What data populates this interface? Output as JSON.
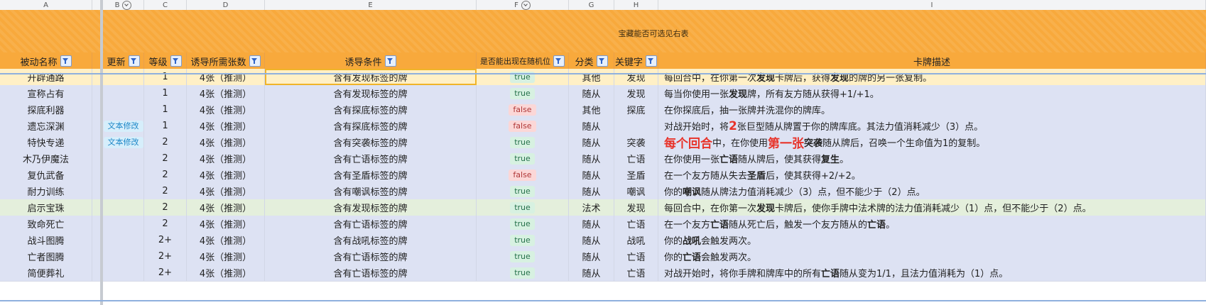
{
  "columns": [
    "A",
    "B",
    "C",
    "D",
    "E",
    "F",
    "G",
    "H",
    "I"
  ],
  "banner_text": "宝藏能否可选见右表",
  "headers": {
    "name": "被动名称",
    "update": "更新",
    "level": "等级",
    "cards_needed": "诱导所需张数",
    "condition": "诱导条件",
    "random_slot": "是否能出现在随机位",
    "category": "分类",
    "keyword": "关键字",
    "description": "卡牌描述"
  },
  "colors": {
    "header_orange": "#f8a93c",
    "row_default": "#dde2f3",
    "row_selected": "#fff0c6",
    "row_highlight": "#e4efdc",
    "true_pill": "#d7f1e1",
    "false_pill": "#fbd7d7",
    "emphasis_red": "#e8332a"
  },
  "rows": [
    {
      "name": "开辟通路",
      "update": "",
      "level": "1",
      "cards": "4张（推测）",
      "condition": "含有发现标签的牌",
      "random": "true",
      "category": "其他",
      "keyword": "发现",
      "desc": [
        {
          "t": "每回合中，在你第一次"
        },
        {
          "t": "发现",
          "b": true
        },
        {
          "t": "卡牌后，获得"
        },
        {
          "t": "发现",
          "b": true
        },
        {
          "t": "的牌的另一张复制。"
        }
      ]
    },
    {
      "name": "宣称占有",
      "update": "",
      "level": "1",
      "cards": "4张（推测）",
      "condition": "含有发现标签的牌",
      "random": "true",
      "category": "随从",
      "keyword": "发现",
      "desc": [
        {
          "t": "每当你使用一张"
        },
        {
          "t": "发现",
          "b": true
        },
        {
          "t": "牌，所有友方随从获得+1/+1。"
        }
      ]
    },
    {
      "name": "探底利器",
      "update": "",
      "level": "1",
      "cards": "4张（推测）",
      "condition": "含有探底标签的牌",
      "random": "false",
      "category": "其他",
      "keyword": "探底",
      "desc": [
        {
          "t": "在你探底后，抽一张牌并洗混你的牌库。"
        }
      ]
    },
    {
      "name": "遗忘深渊",
      "update": "文本修改",
      "level": "1",
      "cards": "4张（推测）",
      "condition": "含有探底标签的牌",
      "random": "false",
      "category": "随从",
      "keyword": "",
      "desc": [
        {
          "t": "对战开始时，将"
        },
        {
          "t": "2",
          "r": true
        },
        {
          "t": "张巨型随从牌置于你的牌库底。其法力值消耗减少（3）点。"
        }
      ]
    },
    {
      "name": "特快专递",
      "update": "文本修改",
      "level": "2",
      "cards": "4张（推测）",
      "condition": "含有突袭标签的牌",
      "random": "true",
      "category": "随从",
      "keyword": "突袭",
      "desc": [
        {
          "t": "每个回合",
          "r": true
        },
        {
          "t": "中，在你使用"
        },
        {
          "t": "第一张",
          "r": true
        },
        {
          "t": "突袭",
          "b": true
        },
        {
          "t": "随从牌后，召唤一个生命值为1的复制。"
        }
      ]
    },
    {
      "name": "木乃伊魔法",
      "update": "",
      "level": "2",
      "cards": "4张（推测）",
      "condition": "含有亡语标签的牌",
      "random": "true",
      "category": "随从",
      "keyword": "亡语",
      "desc": [
        {
          "t": "在你使用一张"
        },
        {
          "t": "亡语",
          "b": true
        },
        {
          "t": "随从牌后，使其获得"
        },
        {
          "t": "复生",
          "b": true
        },
        {
          "t": "。"
        }
      ]
    },
    {
      "name": "复仇武备",
      "update": "",
      "level": "2",
      "cards": "4张（推测）",
      "condition": "含有圣盾标签的牌",
      "random": "false",
      "category": "随从",
      "keyword": "圣盾",
      "desc": [
        {
          "t": "在一个友方随从失去"
        },
        {
          "t": "圣盾",
          "b": true
        },
        {
          "t": "后，使其获得+2/+2。"
        }
      ]
    },
    {
      "name": "耐力训练",
      "update": "",
      "level": "2",
      "cards": "4张（推测）",
      "condition": "含有嘲讽标签的牌",
      "random": "true",
      "category": "随从",
      "keyword": "嘲讽",
      "desc": [
        {
          "t": "你的"
        },
        {
          "t": "嘲讽",
          "b": true
        },
        {
          "t": "随从牌法力值消耗减少（3）点，但不能少于（2）点。"
        }
      ]
    },
    {
      "name": "启示宝珠",
      "update": "",
      "level": "2",
      "cards": "4张（推测）",
      "condition": "含有发现标签的牌",
      "random": "true",
      "category": "法术",
      "keyword": "发现",
      "desc": [
        {
          "t": "每回合中，在你第一次"
        },
        {
          "t": "发现",
          "b": true
        },
        {
          "t": "卡牌后，使你手牌中法术牌的法力值消耗减少（1）点，但不能少于（2）点。"
        }
      ]
    },
    {
      "name": "致命死亡",
      "update": "",
      "level": "2",
      "cards": "4张（推测）",
      "condition": "含有亡语标签的牌",
      "random": "true",
      "category": "随从",
      "keyword": "亡语",
      "desc": [
        {
          "t": "在一个友方"
        },
        {
          "t": "亡语",
          "b": true
        },
        {
          "t": "随从死亡后，触发一个友方随从的"
        },
        {
          "t": "亡语",
          "b": true
        },
        {
          "t": "。"
        }
      ]
    },
    {
      "name": "战斗图腾",
      "update": "",
      "level": "2+",
      "cards": "4张（推测）",
      "condition": "含有战吼标签的牌",
      "random": "true",
      "category": "随从",
      "keyword": "战吼",
      "desc": [
        {
          "t": "你的"
        },
        {
          "t": "战吼",
          "b": true
        },
        {
          "t": "会触发两次。"
        }
      ]
    },
    {
      "name": "亡者图腾",
      "update": "",
      "level": "2+",
      "cards": "4张（推测）",
      "condition": "含有亡语标签的牌",
      "random": "true",
      "category": "随从",
      "keyword": "亡语",
      "desc": [
        {
          "t": "你的"
        },
        {
          "t": "亡语",
          "b": true
        },
        {
          "t": "会触发两次。"
        }
      ]
    },
    {
      "name": "简便葬礼",
      "update": "",
      "level": "2+",
      "cards": "4张（推测）",
      "condition": "含有亡语标签的牌",
      "random": "true",
      "category": "随从",
      "keyword": "亡语",
      "desc": [
        {
          "t": "对战开始时，将你手牌和牌库中的所有"
        },
        {
          "t": "亡语",
          "b": true
        },
        {
          "t": "随从变为1/1，且法力值消耗为（1）点。"
        }
      ]
    }
  ]
}
